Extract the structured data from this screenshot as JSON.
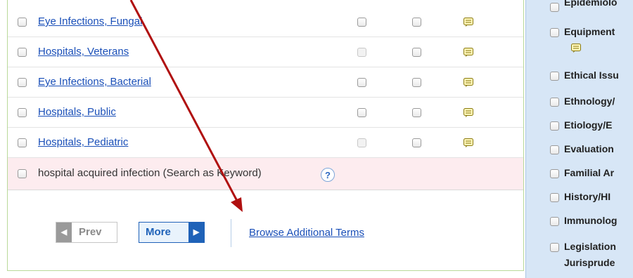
{
  "results": {
    "rows": [
      {
        "term": "Eye Infections, Fungal",
        "col1_disabled": false
      },
      {
        "term": "Hospitals, Veterans",
        "col1_disabled": true
      },
      {
        "term": "Eye Infections, Bacterial",
        "col1_disabled": false
      },
      {
        "term": "Hospitals, Public",
        "col1_disabled": false
      },
      {
        "term": "Hospitals, Pediatric",
        "col1_disabled": true
      }
    ],
    "keyword_row": {
      "text": "hospital acquired infection (Search as Keyword)",
      "help": "?"
    }
  },
  "pager": {
    "prev_label": "Prev",
    "prev_arrow": "◀",
    "more_label": "More",
    "more_arrow": "▶",
    "browse_label": "Browse Additional Terms"
  },
  "subheadings": {
    "items": [
      {
        "label": "Epidemiolo"
      },
      {
        "label": "Equipment"
      },
      {
        "label": "Ethical Issu"
      },
      {
        "label": "Ethnology/"
      },
      {
        "label": "Etiology/E"
      },
      {
        "label": "Evaluation"
      },
      {
        "label": "Familial Ar"
      },
      {
        "label": "History/HI"
      },
      {
        "label": "Immunolog"
      },
      {
        "label": "Legislation"
      },
      {
        "label": "Jurisprude"
      }
    ]
  },
  "colors": {
    "link": "#1a4fb8",
    "panel_border": "#b9d99a",
    "keyword_row_bg": "#fdecef",
    "subpanel_bg": "#d7e6f6",
    "annotation_arrow": "#b01010"
  },
  "icons": {
    "note": "note-icon",
    "help": "help-icon"
  }
}
